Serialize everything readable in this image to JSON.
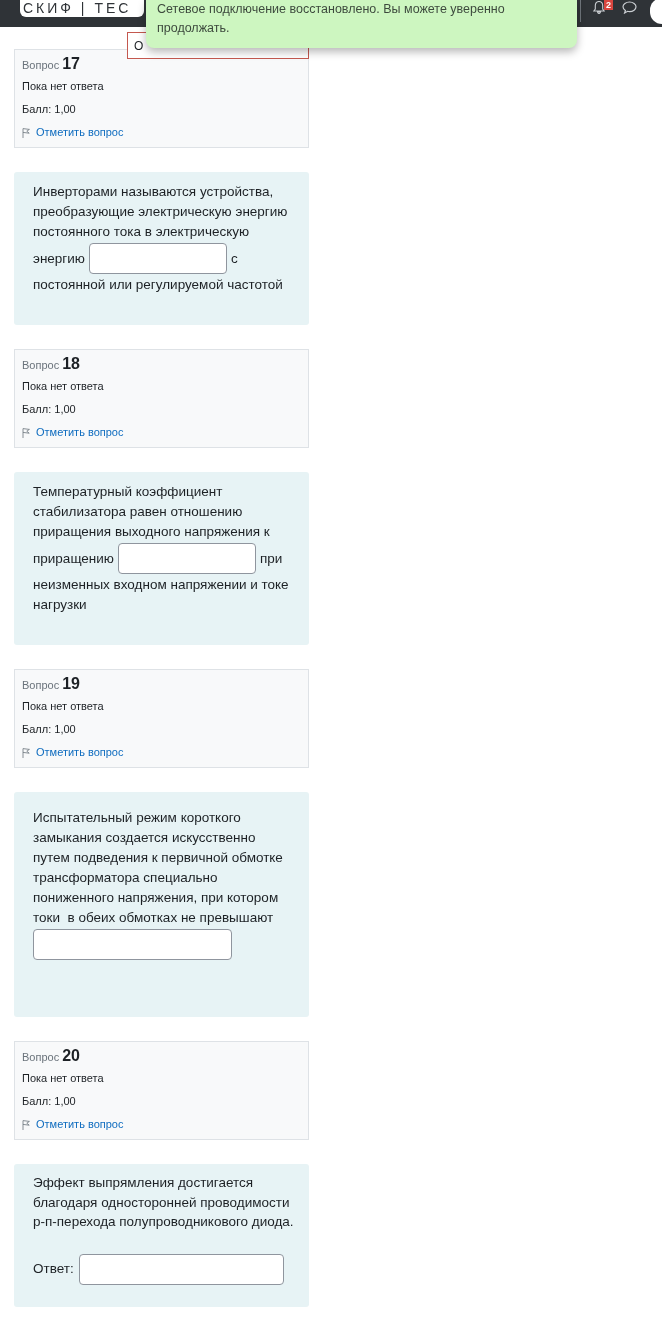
{
  "header": {
    "logo": "СКИФ | ТЕС",
    "notification_badge": "2"
  },
  "covered_button": {
    "label": "О"
  },
  "toast": {
    "message": "Сетевое подключение восстановлено. Вы можете уверенно продолжать."
  },
  "questions": [
    {
      "label": "Вопрос",
      "number": "17",
      "status": "Пока нет ответа",
      "grade": "Балл: 1,00",
      "flag_link": "Отметить вопрос",
      "kind": "inline_blank",
      "text_before": "Инверторами называются устройства, преобразующие электрическую энергию постоянного тока в электрическую",
      "word_before_blank": "энергию",
      "word_after_blank": "с",
      "text_after": "постоянной или регулируемой частотой"
    },
    {
      "label": "Вопрос",
      "number": "18",
      "status": "Пока нет ответа",
      "grade": "Балл: 1,00",
      "flag_link": "Отметить вопрос",
      "kind": "inline_blank",
      "text_before": "Температурный коэффициент стабилизатора равен отношению приращения выходного напряжения к",
      "word_before_blank": "приращению",
      "word_after_blank": "при",
      "text_after": "неизменных входном напряжении и токе нагрузки"
    },
    {
      "label": "Вопрос",
      "number": "19",
      "status": "Пока нет ответа",
      "grade": "Балл: 1,00",
      "flag_link": "Отметить вопрос",
      "kind": "end_blank",
      "text_before": "Испытательный режим короткого замыкания создается искусственно путем подведения к первичной обмотке трансформатора специально пониженного напряжения, при котором токи  в обеих обмотках не превышают"
    },
    {
      "label": "Вопрос",
      "number": "20",
      "status": "Пока нет ответа",
      "grade": "Балл: 1,00",
      "flag_link": "Отметить вопрос",
      "kind": "answer_field",
      "text_before": "Эффект выпрямления достигается благодаря односторонней проводимости р-п-перехода полупроводникового диода.",
      "answer_label": "Ответ:"
    }
  ]
}
